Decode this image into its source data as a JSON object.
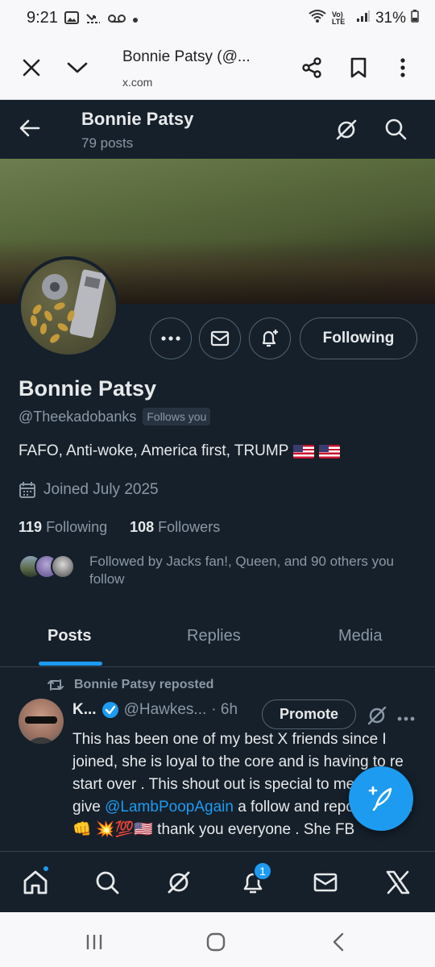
{
  "status_bar": {
    "time": "9:21",
    "battery": "31%",
    "network": "Vo) LTE"
  },
  "browser": {
    "title": "Bonnie Patsy (@...",
    "url": "x.com"
  },
  "header": {
    "name": "Bonnie Patsy",
    "posts": "79 posts"
  },
  "profile": {
    "name": "Bonnie Patsy",
    "handle": "@Theekadobanks",
    "follows_you": "Follows you",
    "bio": "FAFO, Anti-woke, America first, TRUMP",
    "joined": "Joined July 2025",
    "following_count": "119",
    "following_label": "Following",
    "followers_count": "108",
    "followers_label": "Followers",
    "followed_by": "Followed by Jacks fan!, Queen, and 90 others you follow",
    "following_button": "Following"
  },
  "tabs": [
    "Posts",
    "Replies",
    "Media"
  ],
  "tweet": {
    "repost_label": "Bonnie Patsy reposted",
    "name": "K...",
    "handle": "@Hawkes...",
    "time": "· 6h",
    "promote": "Promote",
    "text_1": "This has been one of my best X friends since I joined, she is loyal to the core and is having to re start over . This shout out is special  to me please give ",
    "mention": "@LambPoopAgain",
    "text_2": " a follow and repost 👍 🫶👊 💥💯🇺🇸 thank you everyone . She FB"
  },
  "nav": {
    "notifications_badge": "1"
  },
  "colors": {
    "accent": "#1d9bf0",
    "background": "#15202b",
    "muted": "#8b98a5"
  }
}
